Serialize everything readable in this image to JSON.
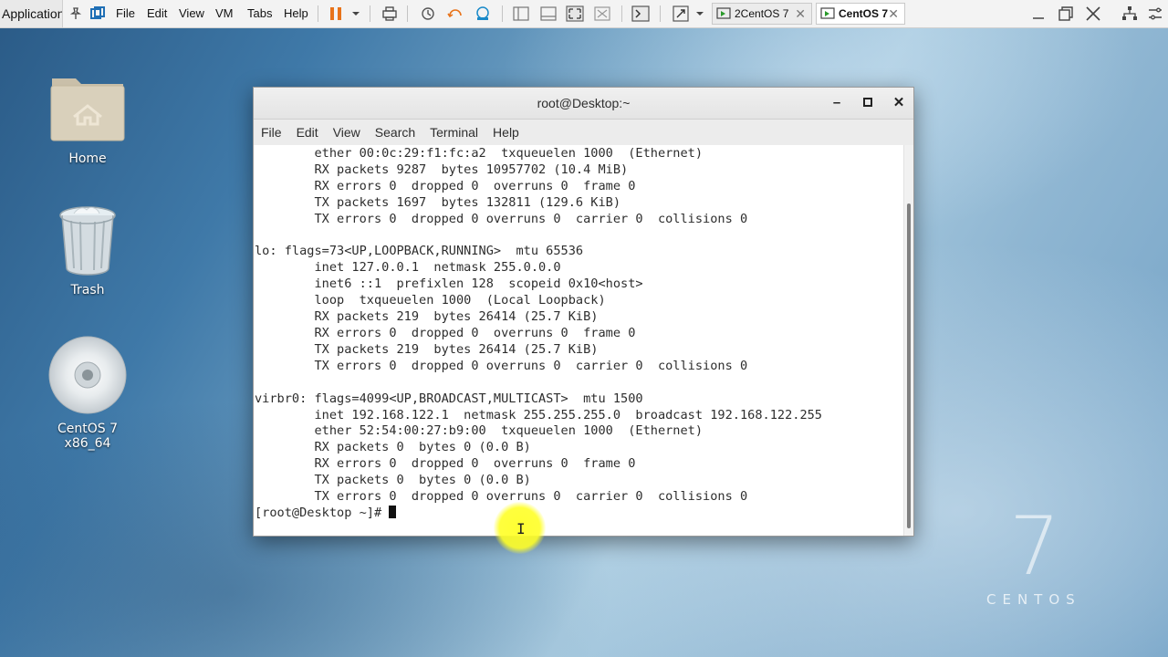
{
  "host": {
    "app_label": "Application",
    "menu": [
      "File",
      "Edit",
      "View",
      "VM",
      "Tabs",
      "Help"
    ],
    "tabs": [
      {
        "label": "2CentOS 7",
        "active": false
      },
      {
        "label": "CentOS 7",
        "active": true
      }
    ]
  },
  "desktop": {
    "icons": [
      {
        "label": "Home",
        "icon": "folder-home-icon"
      },
      {
        "label": "Trash",
        "icon": "trash-icon"
      },
      {
        "label": "CentOS 7 x86_64",
        "icon": "cd-disc-icon"
      }
    ],
    "brand_number": "7",
    "brand_text": "CENTOS"
  },
  "terminal": {
    "title": "root@Desktop:~",
    "menu": [
      "File",
      "Edit",
      "View",
      "Search",
      "Terminal",
      "Help"
    ],
    "output": "        ether 00:0c:29:f1:fc:a2  txqueuelen 1000  (Ethernet)\n        RX packets 9287  bytes 10957702 (10.4 MiB)\n        RX errors 0  dropped 0  overruns 0  frame 0\n        TX packets 1697  bytes 132811 (129.6 KiB)\n        TX errors 0  dropped 0 overruns 0  carrier 0  collisions 0\n\nlo: flags=73<UP,LOOPBACK,RUNNING>  mtu 65536\n        inet 127.0.0.1  netmask 255.0.0.0\n        inet6 ::1  prefixlen 128  scopeid 0x10<host>\n        loop  txqueuelen 1000  (Local Loopback)\n        RX packets 219  bytes 26414 (25.7 KiB)\n        RX errors 0  dropped 0  overruns 0  frame 0\n        TX packets 219  bytes 26414 (25.7 KiB)\n        TX errors 0  dropped 0 overruns 0  carrier 0  collisions 0\n\nvirbr0: flags=4099<UP,BROADCAST,MULTICAST>  mtu 1500\n        inet 192.168.122.1  netmask 255.255.255.0  broadcast 192.168.122.255\n        ether 52:54:00:27:b9:00  txqueuelen 1000  (Ethernet)\n        RX packets 0  bytes 0 (0.0 B)\n        RX errors 0  dropped 0  overruns 0  frame 0\n        TX packets 0  bytes 0 (0.0 B)\n        TX errors 0  dropped 0 overruns 0  carrier 0  collisions 0\n",
    "prompt": "[root@Desktop ~]# "
  },
  "colors": {
    "pointer_highlight": "#ffff28",
    "terminal_bg": "#ffffff",
    "terminal_text": "#2d2d2d"
  }
}
